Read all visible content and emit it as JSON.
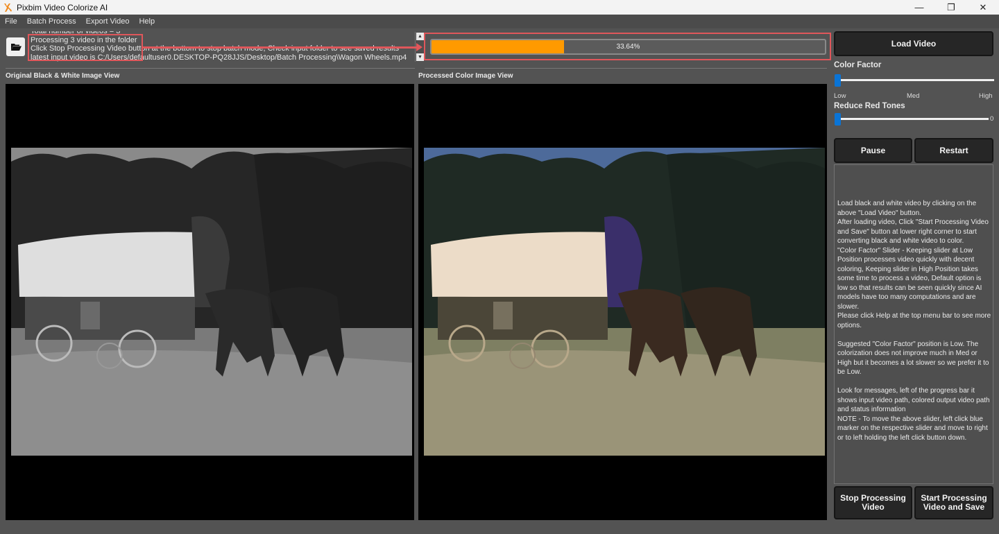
{
  "window": {
    "title": "Pixbim Video Colorize AI",
    "controls": {
      "minimize": "—",
      "maximize": "❐",
      "close": "✕"
    }
  },
  "menu": {
    "items": [
      {
        "label": "File"
      },
      {
        "label": "Batch Process"
      },
      {
        "label": "Export Video"
      },
      {
        "label": "Help"
      }
    ]
  },
  "toolbar": {
    "folder_icon": "folder-open-icon",
    "messages": [
      "Total number of videos = 3",
      "Processing 3 video in the folder",
      "Click Stop Processing Video button at the bottom to stop batch mode, Check input folder to see saved results",
      "latest input video is C:/Users/defaultuser0.DESKTOP-PQ28JJS/Desktop/Batch Processing\\Wagon Wheels.mp4"
    ],
    "progress": {
      "percent": 33.64,
      "label": "33.64%",
      "fill_color": "#ff9a00"
    },
    "annotation_color": "#e0575b"
  },
  "views": {
    "original_label": "Original Black & White Image View",
    "processed_label": "Processed Color Image View"
  },
  "side_panel": {
    "load_video": "Load Video",
    "color_factor": {
      "label": "Color Factor",
      "value_fraction": 0,
      "ticks": [
        "Low",
        "Med",
        "High"
      ]
    },
    "reduce_red": {
      "label": "Reduce Red Tones",
      "value": "0",
      "value_fraction": 0
    },
    "pause": "Pause",
    "restart": "Restart",
    "help_text": "Load black and white video by clicking on the above \"Load Video\" button.\nAfter loading video, Click \"Start Processing Video and Save\" button at lower right corner to start converting black and white video to color.\n\"Color Factor\" Slider - Keeping slider at Low Position processes video quickly with decent coloring, Keeping slider in High Position takes some time to process a video, Default option is low so that results can be seen quickly since AI models have too many computations and are slower.\nPlease click Help at the top menu bar to see more options.\n\nSuggested \"Color Factor\" position is Low. The colorization does not improve much in Med or High but it becomes a lot slower so we prefer it to be Low.\n\nLook for messages, left of the progress bar it shows input video path, colored output video path and status information\nNOTE - To move the above slider, left click blue marker on the respective slider and move to right or to left holding the left click button down.",
    "stop_processing": "Stop Processing Video",
    "start_processing": "Start Processing Video and Save"
  }
}
